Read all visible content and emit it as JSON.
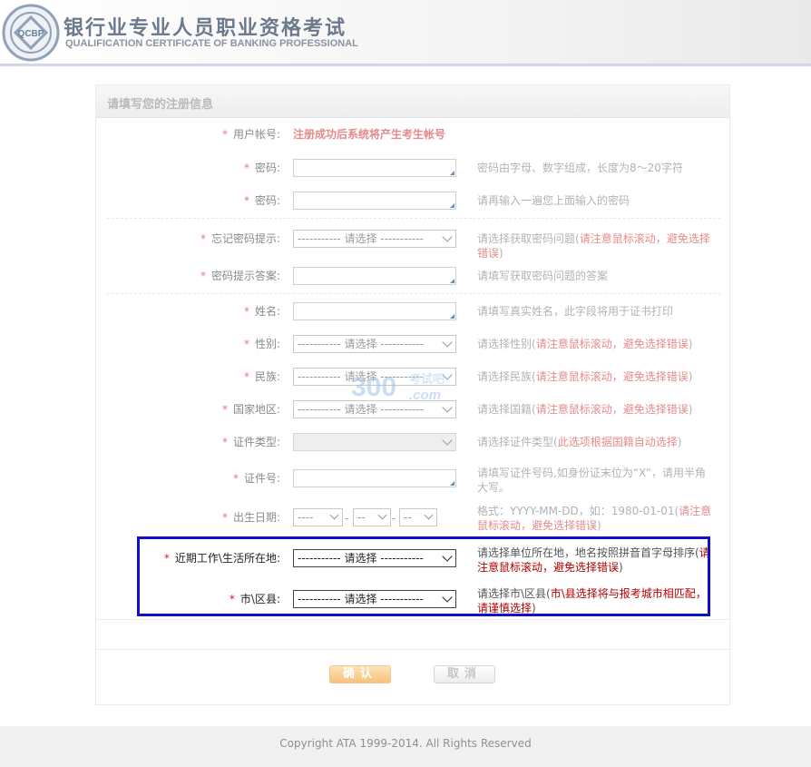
{
  "header": {
    "logo_badge": "QCBP",
    "title_cn": "银行业专业人员职业资格考试",
    "title_en": "QUALIFICATION CERTIFICATE OF BANKING PROFESSIONAL"
  },
  "form": {
    "section_title": "请填写您的注册信息",
    "required_mark": "*",
    "select_placeholder": "----------- 请选择 -----------",
    "rows": {
      "account": {
        "label": "用户帐号:",
        "notice": "注册成功后系统将产生考生帐号"
      },
      "password": {
        "label": "密码:",
        "hint": "密码由字母、数字组成，长度为8～20字符"
      },
      "password_confirm": {
        "label": "密码:",
        "hint": "请再输入一遍您上面输入的密码"
      },
      "pw_question": {
        "label": "忘记密码提示:",
        "hint_pre": "请选择获取密码问题(",
        "hint_red": "请注意鼠标滚动，避免选择错误",
        "hint_post": ")"
      },
      "pw_answer": {
        "label": "密码提示答案:",
        "hint": "请填写获取密码问题的答案"
      },
      "name": {
        "label": "姓名:",
        "hint": "请填写真实姓名，此字段将用于证书打印"
      },
      "gender": {
        "label": "性别:",
        "hint_pre": "请选择性别(",
        "hint_red": "请注意鼠标滚动，避免选择错误",
        "hint_post": ")"
      },
      "ethnicity": {
        "label": "民族:",
        "hint_pre": "请选择民族(",
        "hint_red": "请注意鼠标滚动，避免选择错误",
        "hint_post": ")"
      },
      "country": {
        "label": "国家地区:",
        "hint_pre": "请选择国籍(",
        "hint_red": "请注意鼠标滚动，避免选择错误",
        "hint_post": ")"
      },
      "id_type": {
        "label": "证件类型:",
        "hint_pre": "请选择证件类型(",
        "hint_red": "此选项根据国籍自动选择",
        "hint_post": ")"
      },
      "id_number": {
        "label": "证件号:",
        "hint": "请填写证件号码,如身份证末位为“X”，请用半角大写。"
      },
      "birth": {
        "label": "出生日期:",
        "year": "----",
        "month": "--",
        "day": "--",
        "sep": "-",
        "hint_pre": "格式：YYYY-MM-DD，如：1980-01-01(",
        "hint_red": "请注意鼠标滚动，避免选择错误",
        "hint_post": ")"
      },
      "location": {
        "label": "近期工作\\生活所在地:",
        "hint_pre": "请选择单位所在地，地名按照拼音首字母排序(",
        "hint_red": "请注意鼠标滚动，避免选择错误",
        "hint_post": ")"
      },
      "district": {
        "label": "市\\区县:",
        "hint_pre": "请选择市\\区县(",
        "hint_red": "市\\县选择将与报考城市相匹配，请谨慎选择",
        "hint_post": ")"
      }
    },
    "buttons": {
      "confirm": "确认",
      "cancel": "取消"
    }
  },
  "watermark": {
    "number": "300",
    "text_top": "考试吧",
    "text_bottom": ".com"
  },
  "footer": {
    "copyright": "Copyright ATA 1999-2014. All Rights Reserved"
  },
  "colors": {
    "highlight_border": "#1010cc",
    "required": "#e37a7a",
    "brand_gray": "#6b7a8c"
  }
}
